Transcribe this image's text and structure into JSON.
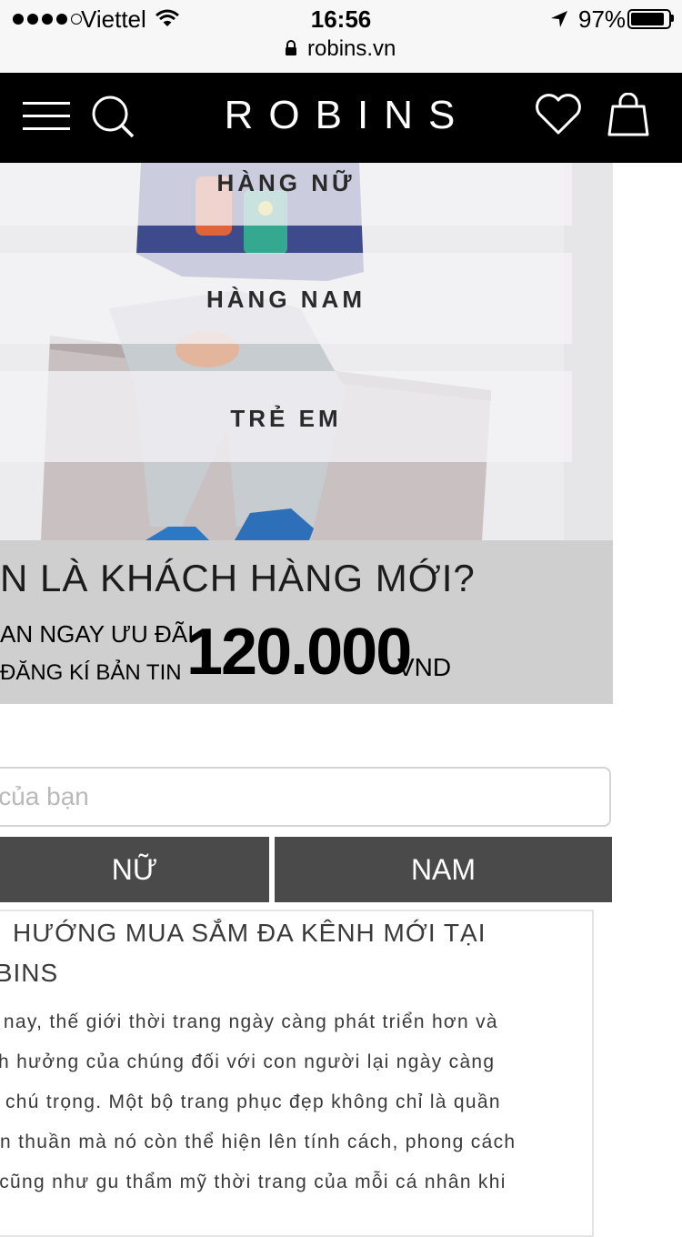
{
  "status_bar": {
    "carrier": "Viettel",
    "time": "16:56",
    "battery": "97%",
    "url": "robins.vn"
  },
  "header": {
    "logo": "ROBINS"
  },
  "hero": {
    "menu": [
      {
        "label": "HÀNG NỮ"
      },
      {
        "label": "HÀNG NAM"
      },
      {
        "label": "TRẺ EM"
      }
    ]
  },
  "promo": {
    "headline": "N LÀ KHÁCH HÀNG MỚI?",
    "line1": "AN NGAY ƯU ĐÃI",
    "line2": "ĐĂNG KÍ BẢN TIN",
    "amount": "120.000",
    "currency": "VND"
  },
  "signup": {
    "email_placeholder": "il của bạn",
    "female_button": "NỮ",
    "male_button": "NAM"
  },
  "article": {
    "title": "HƯỚNG MUA SẮM ĐA KÊNH MỚI TẠI OBINS",
    "title_line1": "HƯỚNG MUA SẮM ĐA KÊNH MỚI TẠI",
    "title_line2": "OBINS",
    "lines": [
      "ay nay, thế giới thời trang ngày càng phát triển hơn và",
      " ảnh hưởng của chúng đối với con người lại ngày càng",
      "ợc chú trọng. Một bộ trang phục đẹp không chỉ là quần",
      "đơn thuần mà nó còn thể hiện lên tính cách, phong cách",
      "g, cũng như gu thẩm mỹ thời trang của mỗi cá nhân khi"
    ]
  },
  "colors": {
    "header_bg": "#000000",
    "button_bg": "#4a4a4a",
    "promo_bg": "#cfcfcf"
  }
}
